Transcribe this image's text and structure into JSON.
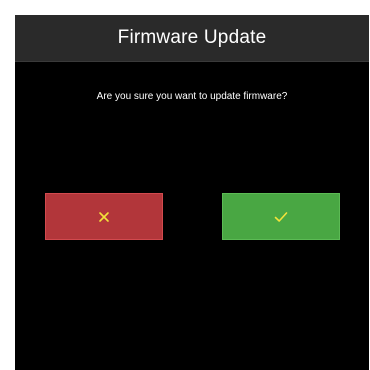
{
  "dialog": {
    "title": "Firmware Update",
    "message": "Are you sure you want to update firmware?"
  },
  "buttons": {
    "cancel": {
      "icon": "close-icon",
      "color": "#b2363a",
      "icon_color": "#f3e33b"
    },
    "confirm": {
      "icon": "check-icon",
      "color": "#49a743",
      "icon_color": "#f3e33b"
    }
  },
  "colors": {
    "background": "#000000",
    "title_bar": "#2a2a2a",
    "text": "#ffffff"
  }
}
